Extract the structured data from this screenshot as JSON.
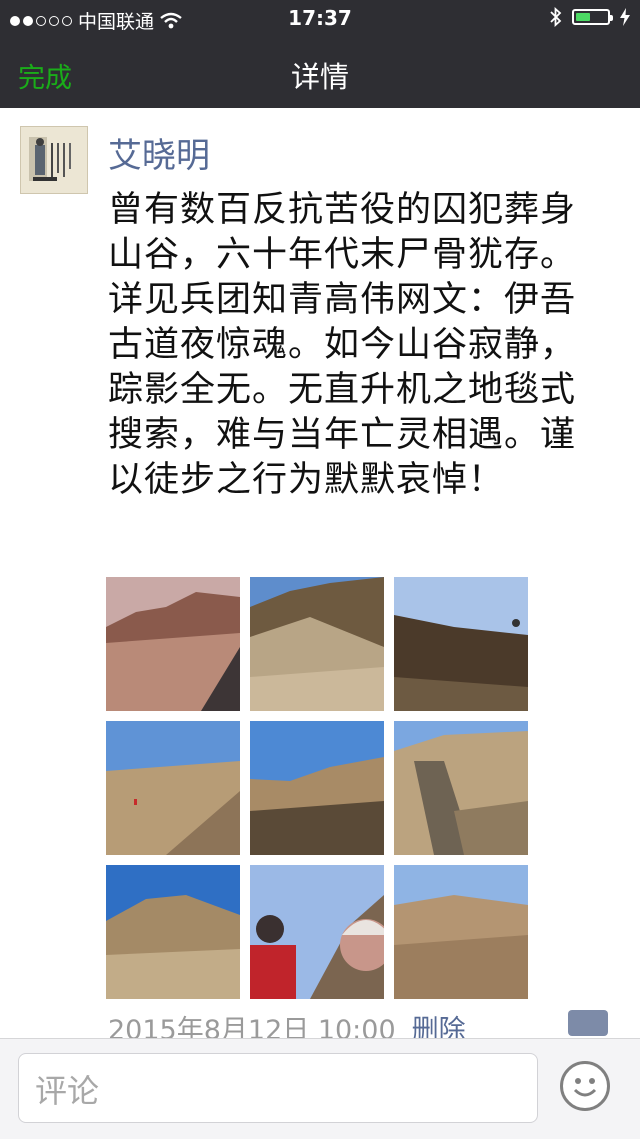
{
  "status_bar": {
    "carrier": "中国联通",
    "time": "17:37",
    "signal_dots_filled": 2,
    "signal_dots_total": 5,
    "battery_level": 0.45
  },
  "nav": {
    "done_label": "完成",
    "title": "详情"
  },
  "post": {
    "author": "艾晓明",
    "text": "曾有数百反抗苦役的囚犯葬身山谷，六十年代末尸骨犹存。详见兵团知青高伟网文：伊吾古道夜惊魂。如今山谷寂静，踪影全无。无直升机之地毯式搜索，难与当年亡灵相遇。谨以徒步之行为默默哀悼！",
    "photos": [
      "desert-valley-road",
      "barren-hills",
      "dark-hillside",
      "desert-slope-figure",
      "rocky-valley",
      "dry-riverbed",
      "rocky-ridge",
      "hikers-selfie",
      "eroded-badlands"
    ],
    "timestamp": "2015年8月12日 10:00",
    "delete_label": "删除"
  },
  "comment_bar": {
    "placeholder": "评论",
    "emoji_icon": "smiley-icon"
  },
  "colors": {
    "nav_bg": "#2e2e33",
    "accent_green": "#1aad19",
    "name_blue": "#566a95",
    "battery_green": "#4cd964"
  }
}
